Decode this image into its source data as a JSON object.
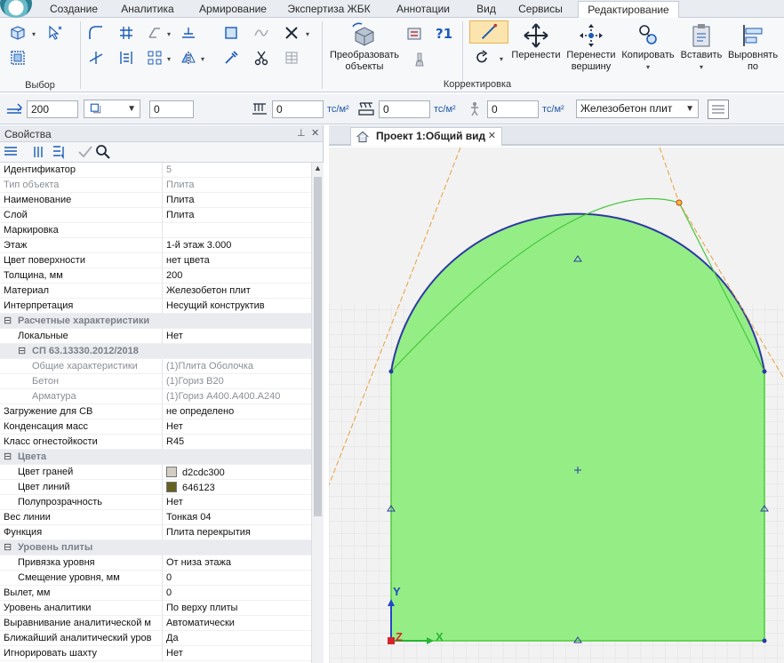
{
  "ribbon": {
    "tabs": [
      "Создание",
      "Аналитика",
      "Армирование",
      "Экспертиза ЖБК",
      "Аннотации",
      "Вид",
      "Сервисы",
      "Редактирование"
    ],
    "active_tab": "Редактирование",
    "groups": {
      "select": "Выбор",
      "edit": "Корректировка"
    },
    "convert": {
      "line1": "Преобразовать",
      "line2": "объекты"
    },
    "move": "Перенести",
    "move_vertex": {
      "line1": "Перенести",
      "line2": "вершину"
    },
    "copy": "Копировать",
    "paste": "Вставить",
    "align": {
      "line1": "Выровнять",
      "line2": "по"
    }
  },
  "toolbar": {
    "thickness": "200",
    "offset": "0",
    "load1": "0",
    "load2": "0",
    "load3": "0",
    "unit": "тс/м²",
    "material": "Железобетон плит"
  },
  "panel": {
    "title": "Свойства",
    "pin": "ș",
    "close": "✕"
  },
  "properties": [
    {
      "k": "Идентификатор",
      "v": "5",
      "vgrey": true
    },
    {
      "k": "Тип объекта",
      "v": "Плита",
      "grey": true
    },
    {
      "k": "Наименование",
      "v": "Плита"
    },
    {
      "k": "Слой",
      "v": "Плита"
    },
    {
      "k": "Маркировка",
      "v": ""
    },
    {
      "k": "Этаж",
      "v": "1-й этаж 3.000"
    },
    {
      "k": "Цвет поверхности",
      "v": "нет цвета"
    },
    {
      "k": "Толщина, мм",
      "v": "200"
    },
    {
      "k": "Материал",
      "v": "Железобетон плит"
    },
    {
      "k": "Интерпретация",
      "v": "Несущий конструктив"
    },
    {
      "k": "Расчетные характеристики",
      "v": "",
      "cat": true,
      "indent": 0
    },
    {
      "k": "Локальные",
      "v": "Нет",
      "indent": 1
    },
    {
      "k": "СП 63.13330.2012/2018",
      "v": "",
      "cat": true,
      "indent": 1
    },
    {
      "k": "Общие характеристики",
      "v": "(1)Плита Оболочка",
      "grey": true,
      "indent": 2
    },
    {
      "k": "Бетон",
      "v": "(1)Гориз B20",
      "grey": true,
      "indent": 2
    },
    {
      "k": "Арматура",
      "v": "(1)Гориз A400.A400.A240",
      "grey": true,
      "indent": 2
    },
    {
      "k": "Загружение для СВ",
      "v": "не определено"
    },
    {
      "k": "Конденсация масс",
      "v": "Нет"
    },
    {
      "k": "Класс огнестойкости",
      "v": "R45"
    },
    {
      "k": "Цвета",
      "v": "",
      "cat": true,
      "indent": 0
    },
    {
      "k": "Цвет граней",
      "v": "d2cdc300",
      "swatch": "#d2cdc3",
      "indent": 1
    },
    {
      "k": "Цвет линий",
      "v": "646123",
      "swatch": "#646123",
      "indent": 1
    },
    {
      "k": "Полупрозрачность",
      "v": "Нет",
      "indent": 1
    },
    {
      "k": "Вес линии",
      "v": "Тонкая 04"
    },
    {
      "k": "Функция",
      "v": "Плита перекрытия"
    },
    {
      "k": "Уровень плиты",
      "v": "",
      "cat": true,
      "indent": 0
    },
    {
      "k": "Привязка уровня",
      "v": "От низа этажа",
      "indent": 1
    },
    {
      "k": "Смещение уровня, мм",
      "v": "0",
      "indent": 1
    },
    {
      "k": "Вылет, мм",
      "v": "0"
    },
    {
      "k": "Уровень аналитики",
      "v": "По верху плиты"
    },
    {
      "k": "Выравнивание аналитической м",
      "v": "Автоматически"
    },
    {
      "k": "Ближайший аналитический уров",
      "v": "Да"
    },
    {
      "k": "Игнорировать шахту",
      "v": "Нет"
    }
  ],
  "viewport": {
    "tab_label": "Проект 1:Общий вид",
    "tab_close": "✕",
    "axis_y": "Y",
    "axis_x": "X",
    "axis_z": "Z"
  },
  "colors": {
    "slab_fill": "#94ee85",
    "slab_edge": "#4ccb3a",
    "arc": "#2d3aa3",
    "guide": "#e8a03c",
    "grid": "#d4d4d4",
    "swatch_faces": "#d2cdc3",
    "swatch_lines": "#646123"
  }
}
